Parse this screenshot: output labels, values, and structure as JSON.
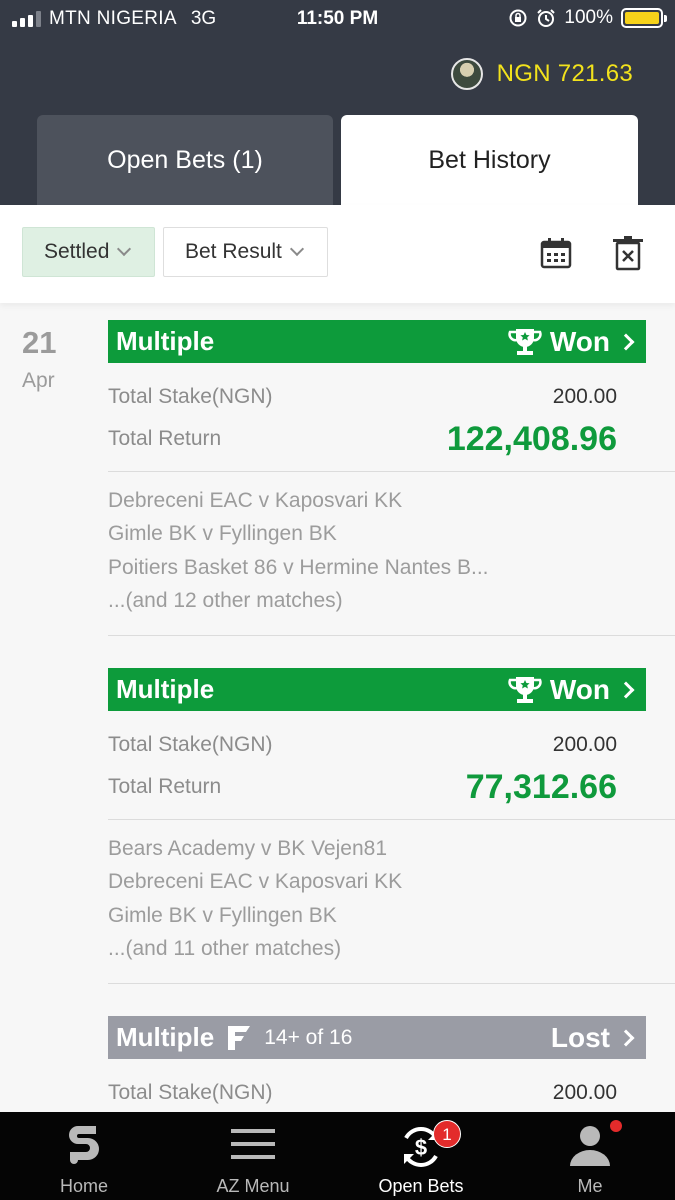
{
  "status_bar": {
    "carrier": "MTN NIGERIA",
    "network": "3G",
    "time": "11:50 PM",
    "battery": "100%",
    "signal_bars": 4,
    "signal_bars_filled": 3
  },
  "header": {
    "balance": "NGN 721.63",
    "tabs": [
      {
        "label": "Open Bets (1)",
        "active": false
      },
      {
        "label": "Bet History",
        "active": true
      }
    ]
  },
  "filters": {
    "settled_label": "Settled",
    "result_label": "Bet Result",
    "icons": [
      "calendar-icon",
      "clear-icon"
    ]
  },
  "date": {
    "day": "21",
    "month": "Apr"
  },
  "bets": [
    {
      "type": "Multiple",
      "status": "Won",
      "stake_label": "Total Stake(NGN)",
      "stake": "200.00",
      "return_label": "Total Return",
      "return": "122,408.96",
      "matches": [
        "Debreceni EAC v Kaposvari KK",
        "Gimle BK v Fyllingen BK",
        "Poitiers Basket 86 v Hermine Nantes B...",
        "...(and 12 other matches)"
      ]
    },
    {
      "type": "Multiple",
      "status": "Won",
      "stake_label": "Total Stake(NGN)",
      "stake": "200.00",
      "return_label": "Total Return",
      "return": "77,312.66",
      "matches": [
        "Bears Academy v BK Vejen81",
        "Debreceni EAC v Kaposvari KK",
        "Gimle BK v Fyllingen BK",
        "...(and 11 other matches)"
      ]
    },
    {
      "type": "Multiple",
      "status": "Lost",
      "flexi_text": "14+ of 16",
      "stake_label": "Total Stake(NGN)",
      "stake": "200.00"
    }
  ],
  "bottom_nav": [
    {
      "label": "Home",
      "icon": "sporty-logo-icon"
    },
    {
      "label": "AZ Menu",
      "icon": "menu-icon"
    },
    {
      "label": "Open Bets",
      "icon": "open-bets-icon",
      "badge": "1",
      "active": true
    },
    {
      "label": "Me",
      "icon": "user-icon"
    }
  ],
  "colors": {
    "header_bg": "#353a45",
    "won_green": "#0d9b3b",
    "lost_grey": "#9a9ca5",
    "balance_yellow": "#f2e21c",
    "badge_red": "#e32b2b"
  }
}
